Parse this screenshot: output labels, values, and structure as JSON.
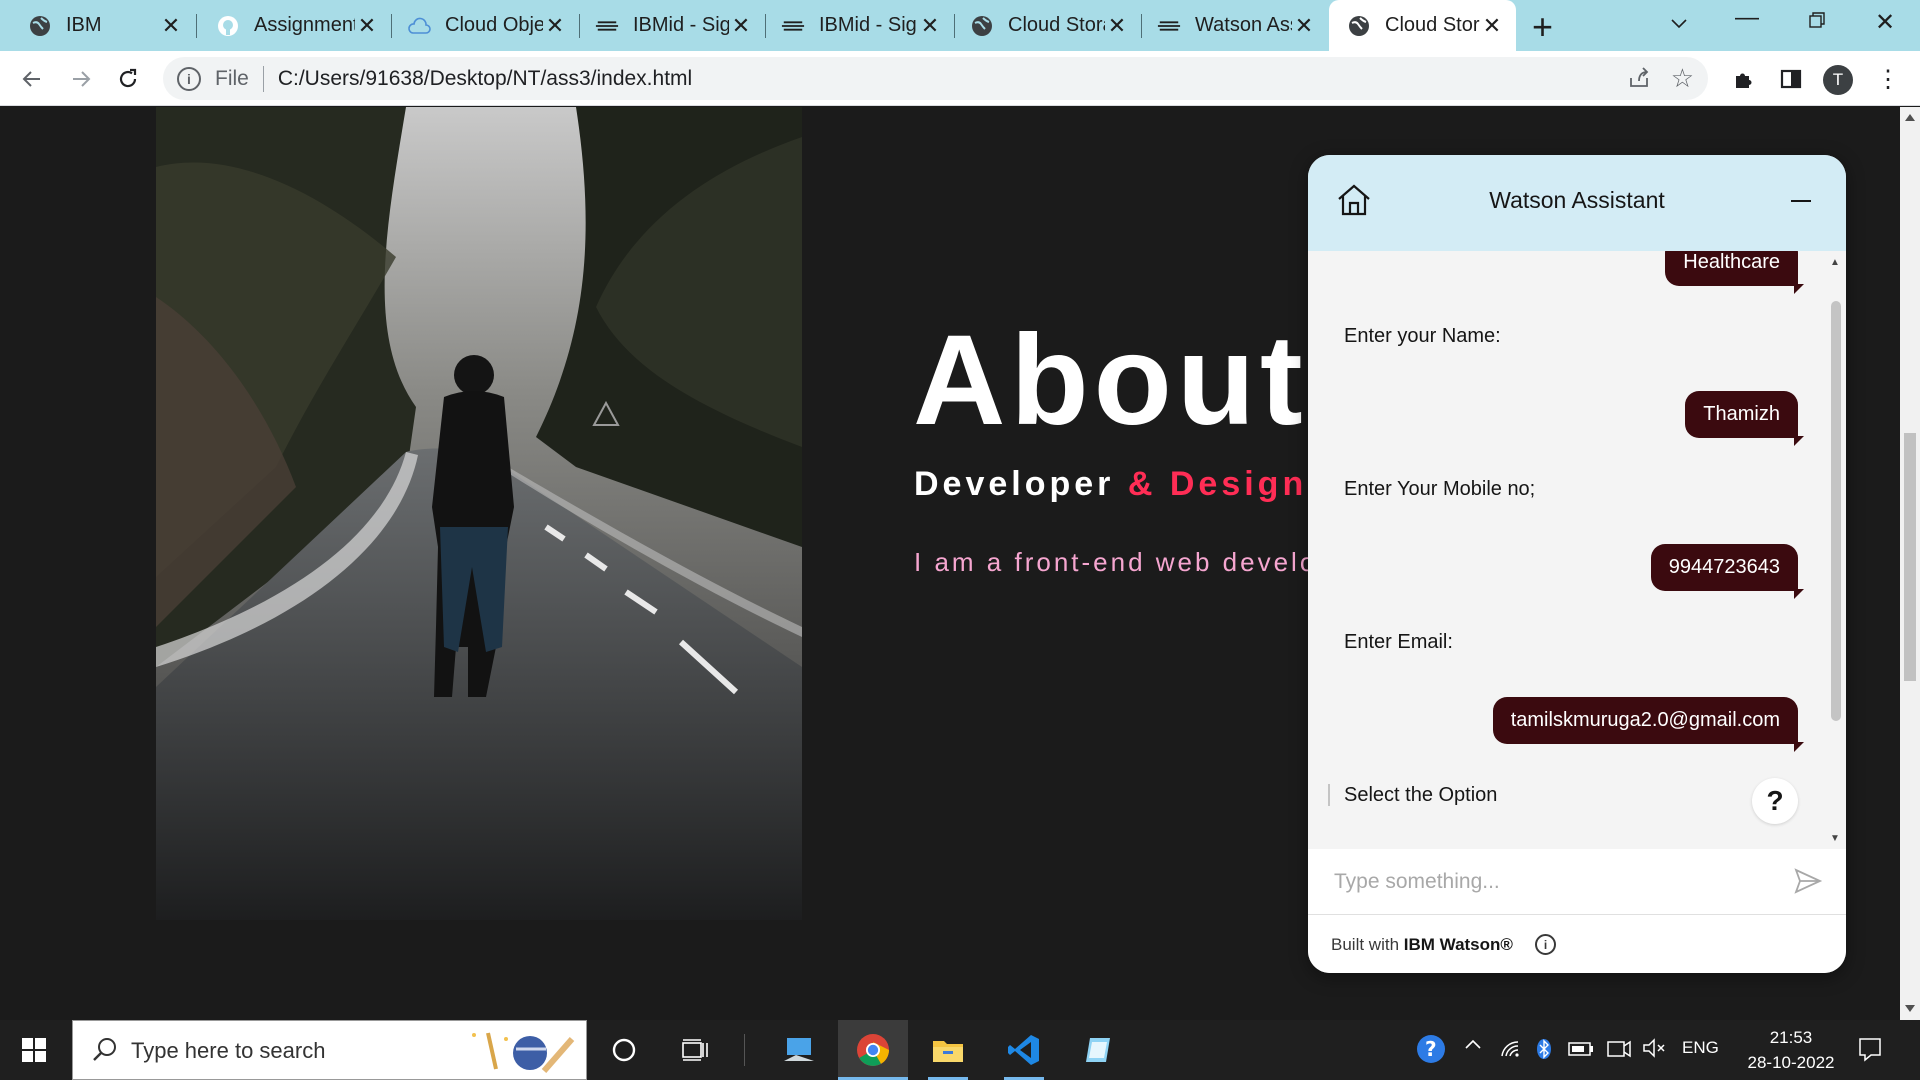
{
  "browser": {
    "tabs": [
      {
        "title": "IBM",
        "icon": "globe-icon",
        "active": false
      },
      {
        "title": "Assignment",
        "icon": "github-icon",
        "active": false
      },
      {
        "title": "Cloud Obje",
        "icon": "cloud-icon",
        "active": false
      },
      {
        "title": "IBMid - Sig",
        "icon": "ibm-bee-icon",
        "active": false
      },
      {
        "title": "IBMid - Sig",
        "icon": "ibm-bee-icon",
        "active": false
      },
      {
        "title": "Cloud Stora",
        "icon": "globe-icon",
        "active": false
      },
      {
        "title": "Watson Ass",
        "icon": "ibm-bee-icon",
        "active": false
      },
      {
        "title": "Cloud Stora",
        "icon": "globe-icon",
        "active": true
      }
    ],
    "address": {
      "scheme_label": "File",
      "url": "C:/Users/91638/Desktop/NT/ass3/index.html"
    },
    "profile_initial": "T"
  },
  "page": {
    "heading": "About M",
    "subtitle_dev": "Developer",
    "subtitle_des": "& Designer",
    "intro": "I am a front-end web develop"
  },
  "watson": {
    "title": "Watson Assistant",
    "messages": [
      {
        "from": "user",
        "text": "Healthcare"
      },
      {
        "from": "bot",
        "text": "Enter your Name:"
      },
      {
        "from": "user",
        "text": "Thamizh"
      },
      {
        "from": "bot",
        "text": "Enter Your Mobile no;"
      },
      {
        "from": "user",
        "text": "9944723643"
      },
      {
        "from": "bot",
        "text": "Enter Email:"
      },
      {
        "from": "user",
        "text": "tamilskmuruga2.0@gmail.com"
      },
      {
        "from": "bot",
        "text": "Select the Option"
      }
    ],
    "help_label": "?",
    "input_placeholder": "Type something...",
    "footer_prefix": "Built with",
    "footer_brand": "IBM Watson®"
  },
  "taskbar": {
    "search_placeholder": "Type here to search",
    "language": "ENG",
    "time": "21:53",
    "date": "28-10-2022"
  },
  "colors": {
    "tabbar": "#a8dce7",
    "page_background": "#1b1b1b",
    "accent_pink": "#ff2d55",
    "intro_text": "#f6a6d0",
    "user_bubble": "#3b0a0f",
    "watson_header": "#d3ecf5"
  }
}
